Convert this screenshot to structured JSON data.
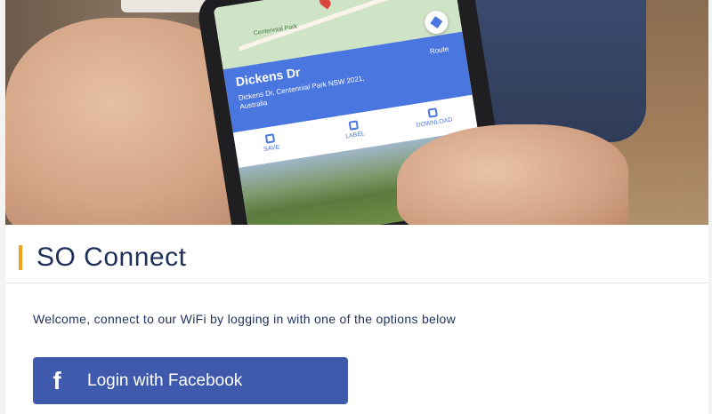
{
  "hero": {
    "phone": {
      "map_label": "Centennial Park",
      "place_name": "Dickens Dr",
      "place_address": "Dickens Dr, Centennial Park NSW 2021, Australia",
      "route_label": "Route",
      "actions": [
        {
          "label": "SAVE",
          "icon": "save-icon"
        },
        {
          "label": "LABEL",
          "icon": "flag-icon"
        },
        {
          "label": "DOWNLOAD",
          "icon": "download-icon"
        }
      ]
    }
  },
  "card": {
    "title": "SO Connect",
    "accent_color": "#f0a11d",
    "title_color": "#1e2f5b",
    "welcome": "Welcome, connect to our WiFi by logging in with one of the options below",
    "facebook_button": {
      "label": "Login with Facebook",
      "icon": "facebook-icon",
      "icon_glyph": "f",
      "color": "#3f59ad"
    }
  }
}
